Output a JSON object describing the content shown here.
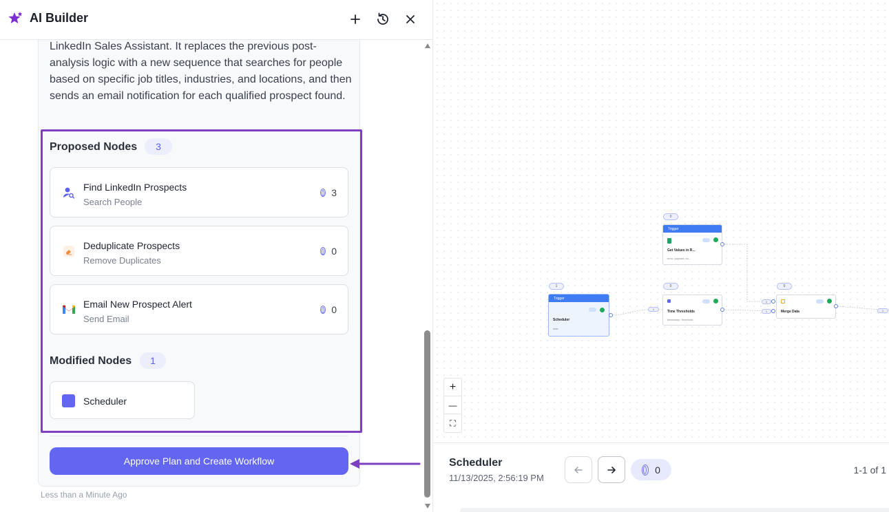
{
  "header": {
    "title": "AI Builder"
  },
  "message": {
    "text": "LinkedIn Sales Assistant. It replaces the previous post-analysis logic with a new sequence that searches for people based on specific job titles, industries, and locations, and then sends an email notification for each qualified prospect found."
  },
  "proposed": {
    "title": "Proposed Nodes",
    "count": "3",
    "nodes": [
      {
        "name": "Find LinkedIn Prospects",
        "type": "Search People",
        "count": "3",
        "icon": "person-search-icon"
      },
      {
        "name": "Deduplicate Prospects",
        "type": "Remove Duplicates",
        "count": "0",
        "icon": "eraser-icon"
      },
      {
        "name": "Email New Prospect Alert",
        "type": "Send Email",
        "count": "0",
        "icon": "gmail-icon"
      }
    ]
  },
  "modified": {
    "title": "Modified Nodes",
    "count": "1",
    "nodes": [
      {
        "name": "Scheduler"
      }
    ]
  },
  "approve_label": "Approve Plan and Create Workflow",
  "timestamp": "Less than a Minute Ago",
  "canvas": {
    "nodes": {
      "scheduler": {
        "head": "Trigger",
        "name": "Scheduler",
        "sub": "date",
        "badge": "1"
      },
      "get_values": {
        "head": "Trigger",
        "name": "Get Values in R...",
        "sub": "error, payload, su...",
        "badge": "0"
      },
      "time_thresholds": {
        "name": "Time Thresholds",
        "sub": "timestamp, threshold",
        "badge": "0"
      },
      "merge_data": {
        "name": "Merge Data",
        "badge": "0"
      }
    },
    "edge_labels": [
      "1",
      "1",
      "1",
      "1"
    ]
  },
  "zoom": {
    "in": "+",
    "out": "—",
    "fit": "⛶"
  },
  "bottom": {
    "title": "Scheduler",
    "date": "11/13/2025, 2:56:19 PM",
    "count": "0",
    "pager": "1-1 of 1"
  },
  "colors": {
    "accent": "#6366f1",
    "highlight": "#7d3fbf",
    "trigger": "#3f7cf3"
  }
}
